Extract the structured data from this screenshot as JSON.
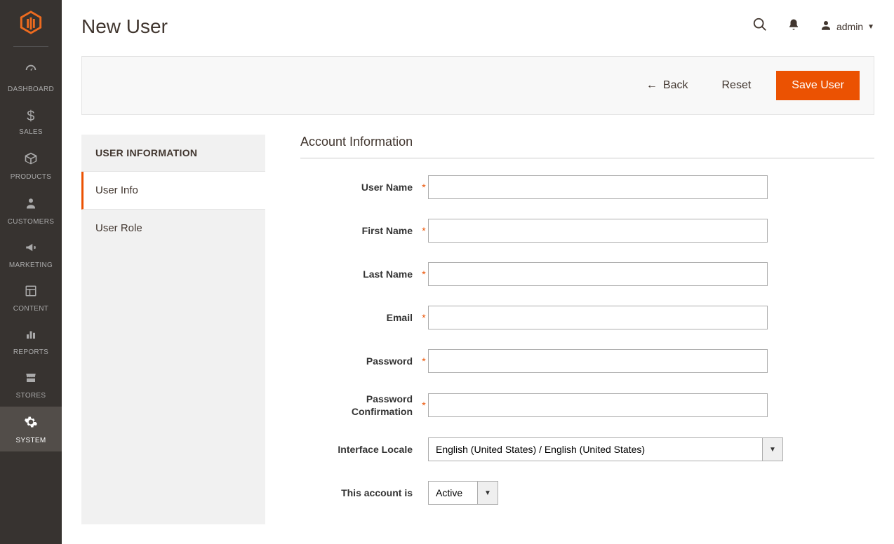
{
  "header": {
    "page_title": "New User",
    "admin_label": "admin"
  },
  "nav": {
    "dashboard": "DASHBOARD",
    "sales": "SALES",
    "products": "PRODUCTS",
    "customers": "CUSTOMERS",
    "marketing": "MARKETING",
    "content": "CONTENT",
    "reports": "REPORTS",
    "stores": "STORES",
    "system": "SYSTEM"
  },
  "actions": {
    "back": "Back",
    "reset": "Reset",
    "save": "Save User"
  },
  "tabs": {
    "heading": "USER INFORMATION",
    "user_info": "User Info",
    "user_role": "User Role"
  },
  "form": {
    "section_title": "Account Information",
    "labels": {
      "username": "User Name",
      "firstname": "First Name",
      "lastname": "Last Name",
      "email": "Email",
      "password": "Password",
      "password_confirm_line1": "Password",
      "password_confirm_line2": "Confirmation",
      "locale": "Interface Locale",
      "account_is": "This account is"
    },
    "values": {
      "username": "",
      "firstname": "",
      "lastname": "",
      "email": "",
      "password": "",
      "password_confirm": "",
      "locale": "English (United States) / English (United States)",
      "account_is": "Active"
    }
  }
}
